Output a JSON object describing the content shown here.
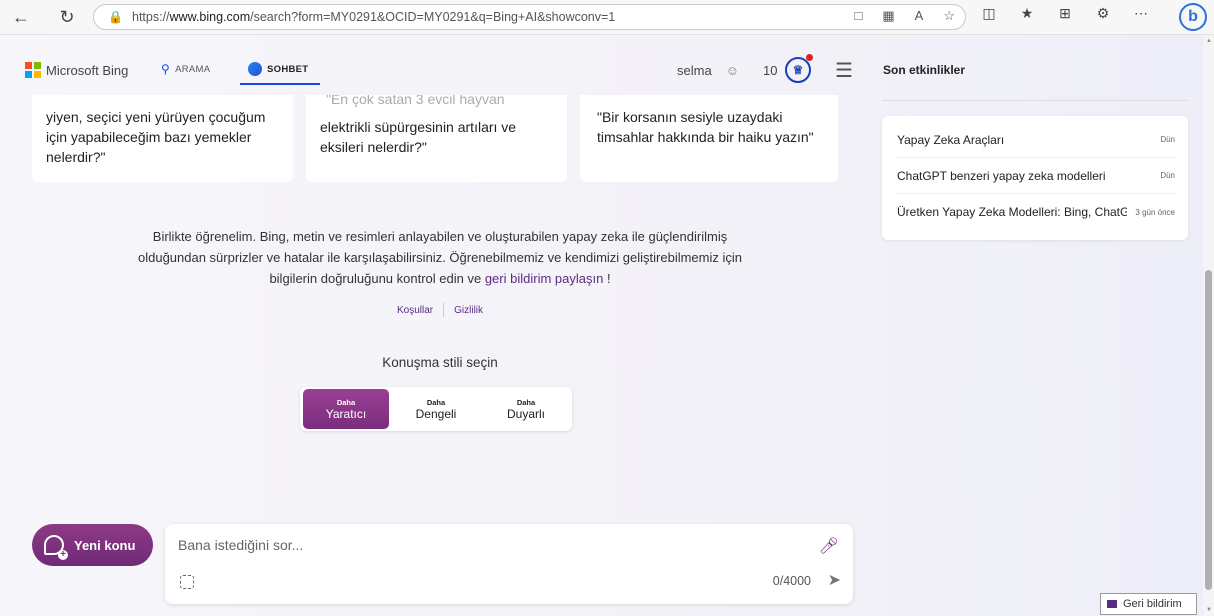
{
  "browser": {
    "url_prefix": "https://",
    "url_host": "www.bing.com",
    "url_path": "/search?form=MY0291&OCID=MY0291&q=Bing+AI&showconv=1"
  },
  "header": {
    "brand": "Microsoft Bing",
    "tab_search": "ARAMA",
    "tab_chat": "SOHBET",
    "username": "selma",
    "points": "10"
  },
  "cards": [
    {
      "faded": "",
      "text": "yiyen, seçici yeni yürüyen çocuğum için yapabileceğim bazı yemekler nelerdir?\""
    },
    {
      "faded": "\"En çok satan 3 evcil hayvan",
      "text": "elektrikli süpürgesinin artıları ve eksileri nelerdir?\""
    },
    {
      "faded": "",
      "text": "\"Bir korsanın sesiyle uzaydaki timsahlar hakkında bir haiku yazın\""
    }
  ],
  "intro": {
    "text": "Birlikte öğrenelim. Bing, metin ve resimleri anlayabilen ve oluşturabilen yapay zeka ile güçlendirilmiş olduğundan sürprizler ve hatalar ile karşılaşabilirsiniz. Öğrenebilmemiz ve kendimizi geliştirebilmemiz için bilgilerin doğruluğunu kontrol edin ve",
    "link": "geri bildirim paylaşın",
    "tail": " !",
    "terms": "Koşullar",
    "privacy": "Gizlilik"
  },
  "style": {
    "title": "Konuşma stili seçin",
    "options": [
      {
        "small": "Daha",
        "big": "Yaratıcı"
      },
      {
        "small": "Daha",
        "big": "Dengeli"
      },
      {
        "small": "Daha",
        "big": "Duyarlı"
      }
    ]
  },
  "composer": {
    "new_topic": "Yeni konu",
    "placeholder": "Bana istediğini sor...",
    "counter": "0/4000"
  },
  "recent": {
    "title": "Son etkinlikler",
    "items": [
      {
        "title": "Yapay Zeka Araçları",
        "when": "Dün"
      },
      {
        "title": "ChatGPT benzeri yapay zeka modelleri",
        "when": "Dün"
      },
      {
        "title": "Üretken Yapay Zeka Modelleri: Bing, ChatGPT",
        "when": "3 gün önce"
      }
    ]
  },
  "feedback": "Geri bildirim"
}
